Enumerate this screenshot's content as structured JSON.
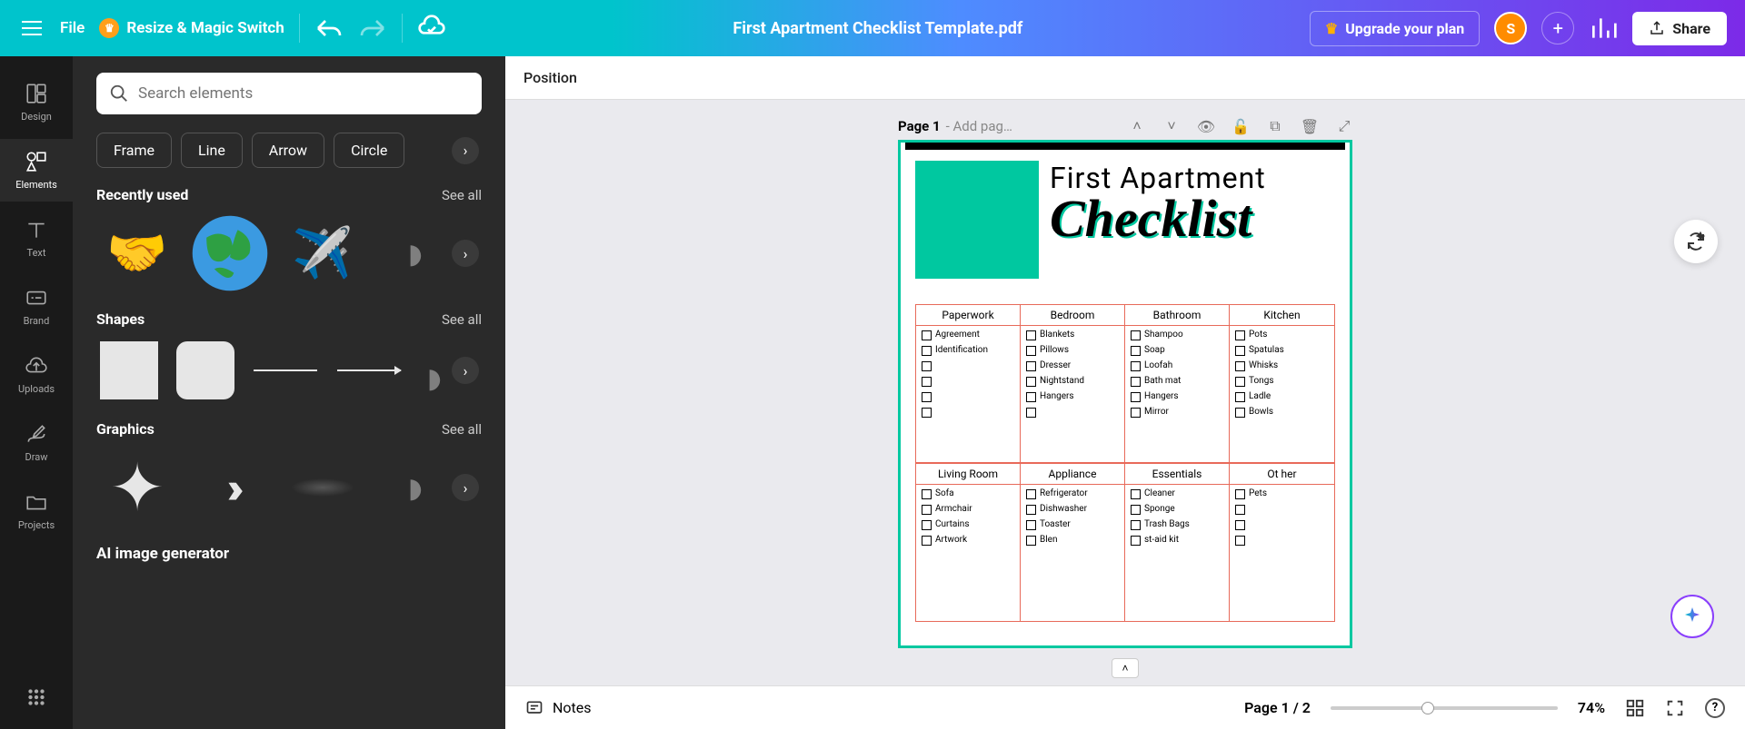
{
  "topbar": {
    "file_label": "File",
    "resize_label": "Resize & Magic Switch",
    "doc_title": "First Apartment Checklist Template.pdf",
    "upgrade_label": "Upgrade your plan",
    "avatar_letter": "S",
    "share_label": "Share"
  },
  "rail": {
    "design": "Design",
    "elements": "Elements",
    "text": "Text",
    "brand": "Brand",
    "uploads": "Uploads",
    "draw": "Draw",
    "projects": "Projects"
  },
  "panel": {
    "search_placeholder": "Search elements",
    "chips": {
      "frame": "Frame",
      "line": "Line",
      "arrow": "Arrow",
      "circle": "Circle"
    },
    "recently_used": "Recently used",
    "shapes": "Shapes",
    "graphics": "Graphics",
    "see_all": "See all",
    "ai_gen": "AI image generator"
  },
  "position": {
    "label": "Position"
  },
  "page_header": {
    "label": "Page 1",
    "add": " - Add pag…"
  },
  "document": {
    "title_line1": "First Apartment",
    "title_line2": "Checklist",
    "sections1": [
      {
        "head": "Paperwork",
        "items": [
          "Agreement",
          "Identification"
        ]
      },
      {
        "head": "Bedroom",
        "items": [
          "Blankets",
          "Pillows",
          "Dresser",
          "Nightstand",
          "Hangers"
        ]
      },
      {
        "head": "Bathroom",
        "items": [
          "Shampoo",
          "Soap",
          "Loofah",
          "Bath mat",
          "Hangers",
          "Mirror"
        ]
      },
      {
        "head": "Kitchen",
        "items": [
          "Pots",
          "Spatulas",
          "Whisks",
          "Tongs",
          "Ladle",
          "Bowls"
        ]
      }
    ],
    "sections2": [
      {
        "head": "Living Room",
        "items": [
          "Sofa",
          "Armchair",
          "Curtains",
          "Artwork"
        ]
      },
      {
        "head": "Appliance",
        "items": [
          "Refrigerator",
          "Dishwasher",
          "Toaster",
          "Blen"
        ]
      },
      {
        "head": "Essentials",
        "items": [
          "Cleaner",
          "Sponge",
          "Trash Bags",
          "st-aid kit"
        ]
      },
      {
        "head": "Ot her",
        "items": [
          "Pets"
        ]
      }
    ]
  },
  "bottom": {
    "notes": "Notes",
    "page_count": "Page 1 / 2",
    "zoom": "74%",
    "help": "?"
  }
}
